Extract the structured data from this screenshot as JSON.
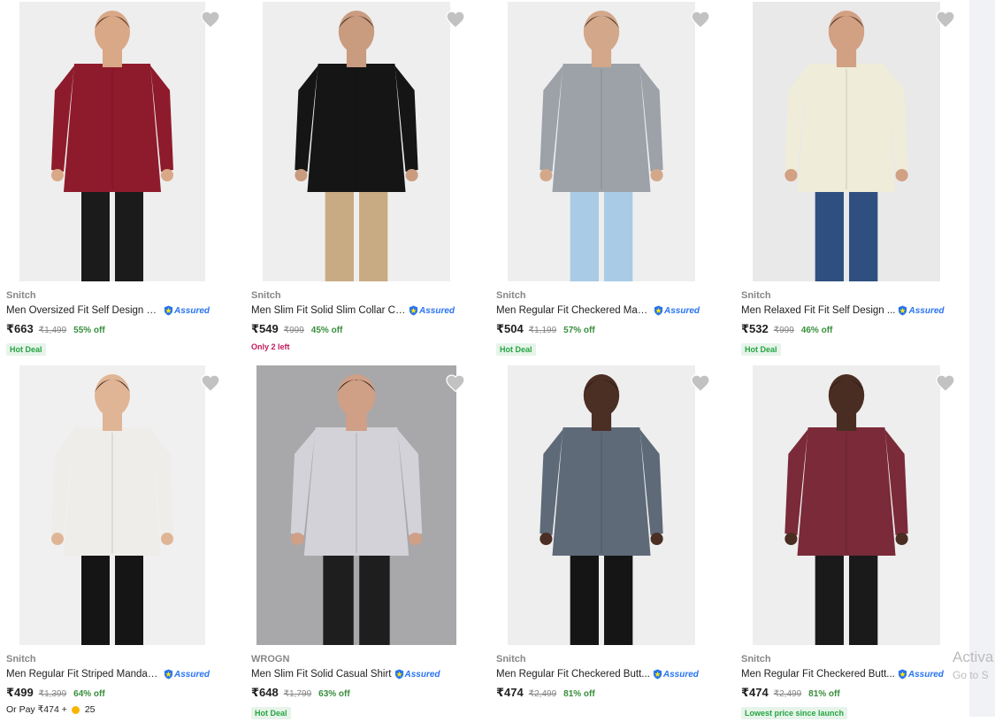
{
  "products": [
    {
      "brand": "Snitch",
      "title": "Men Oversized Fit Self Design C...",
      "assured": "Assured",
      "price": "₹663",
      "mrp": "₹1,499",
      "discount": "55% off",
      "tag": "Hot Deal",
      "shirt": "#8e1b2c",
      "pants": "#1b1b1b",
      "bg": "#eeeeee"
    },
    {
      "brand": "Snitch",
      "title": "Men Slim Fit Solid Slim Collar Ca...",
      "assured": "Assured",
      "price": "₹549",
      "mrp": "₹999",
      "discount": "45% off",
      "tag": "Only 2 left",
      "shirt": "#151515",
      "pants": "#c8ab82",
      "bg": "#eeeeee"
    },
    {
      "brand": "Snitch",
      "title": "Men Regular Fit Checkered Man...",
      "assured": "Assured",
      "price": "₹504",
      "mrp": "₹1,199",
      "discount": "57% off",
      "tag": "Hot Deal",
      "shirt": "#9da1a8",
      "pants": "#a9cbe5",
      "bg": "#eeeeee"
    },
    {
      "brand": "Snitch",
      "title": "Men Relaxed Fit Fit Self Design ...",
      "assured": "Assured",
      "price": "₹532",
      "mrp": "₹999",
      "discount": "46% off",
      "tag": "Hot Deal",
      "shirt": "#efecd9",
      "pants": "#2f4f80",
      "bg": "#e9e9e9"
    },
    {
      "brand": "Snitch",
      "title": "Men Regular Fit Striped Mandari...",
      "assured": "Assured",
      "price": "₹499",
      "mrp": "₹1,399",
      "discount": "64% off",
      "extra": {
        "prefix": "Or Pay ₹474 +",
        "coins": "25"
      },
      "shirt": "#efedea",
      "pants": "#151515",
      "bg": "#f0f0f0"
    },
    {
      "brand": "WROGN",
      "title": "Men Slim Fit Solid Casual Shirt",
      "assured": "Assured",
      "price": "₹648",
      "mrp": "₹1,799",
      "discount": "63% off",
      "tag": "Hot Deal",
      "shirt": "#d2d2d8",
      "pants": "#1e1e1e",
      "bg": "#a8a8ab"
    },
    {
      "brand": "Snitch",
      "title": "Men Regular Fit Checkered Butt...",
      "assured": "Assured",
      "price": "₹474",
      "mrp": "₹2,499",
      "discount": "81% off",
      "shirt": "#5e6a78",
      "pants": "#151515",
      "bg": "#eeeeee"
    },
    {
      "brand": "Snitch",
      "title": "Men Regular Fit Checkered Butt...",
      "assured": "Assured",
      "price": "₹474",
      "mrp": "₹2,499",
      "discount": "81% off",
      "tag": "Lowest price since launch",
      "shirt": "#7a2a38",
      "pants": "#1a1a1a",
      "bg": "#eeeeee"
    }
  ],
  "watermark": {
    "line1": "Activa",
    "line2": "Go to S"
  },
  "colors": {
    "assured_blue": "#2874f0",
    "discount_green": "#388e3c",
    "deal_tag_green": "#26a541",
    "stock_pink": "#c2185b",
    "heart_grey": "#c2c2c2"
  }
}
